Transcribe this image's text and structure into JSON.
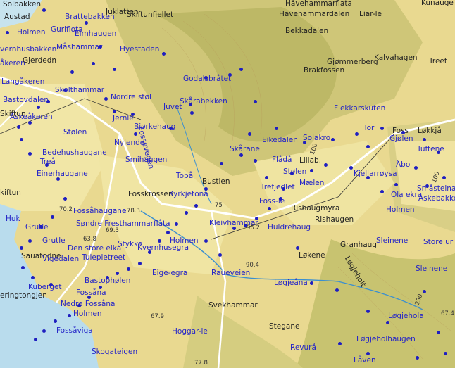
{
  "map": {
    "colors": {
      "land": "#e9d990",
      "hill": "#c9c26a",
      "forest_dark": "#a9ae57",
      "field": "#f1e6a6",
      "water": "#b9dced",
      "road": "#ffffff",
      "place_label": "#2424c8",
      "black_label": "#222222"
    },
    "labels": [
      {
        "id": "solbakken",
        "text": "Solbakken",
        "style": "black"
      },
      {
        "id": "austad",
        "text": "Austad",
        "style": "black"
      },
      {
        "id": "juklatten",
        "text": "Juklatten",
        "style": "black"
      },
      {
        "id": "skiftunfjellet",
        "text": "Skiftunfjellet",
        "style": "black"
      },
      {
        "id": "havehammarflata",
        "text": "Hävehammarflata",
        "style": "black"
      },
      {
        "id": "havehammardalen",
        "text": "Hävehammardalen",
        "style": "black"
      },
      {
        "id": "liar-le",
        "text": "Liar-le",
        "style": "black"
      },
      {
        "id": "kunauge",
        "text": "Kunauge",
        "style": "black"
      },
      {
        "id": "brattebakken",
        "text": "Brattebakken",
        "style": "blue"
      },
      {
        "id": "holmen-1",
        "text": "Holmen",
        "style": "blue"
      },
      {
        "id": "guriflota",
        "text": "Guriflota",
        "style": "blue"
      },
      {
        "id": "elmhaugen",
        "text": "Elmhaugen",
        "style": "blue"
      },
      {
        "id": "bekkadalen",
        "text": "Bekkadalen",
        "style": "black"
      },
      {
        "id": "vernhusbakken",
        "text": "vernhusbakken",
        "style": "blue"
      },
      {
        "id": "mashammar",
        "text": "Måshammar",
        "style": "blue"
      },
      {
        "id": "hyestaden",
        "text": "Hyestaden",
        "style": "blue"
      },
      {
        "id": "kalvahagen",
        "text": "Kalvahagen",
        "style": "black"
      },
      {
        "id": "akeren",
        "text": "åkeren",
        "style": "blue"
      },
      {
        "id": "gjerdedn",
        "text": "Gjerdedn",
        "style": "black"
      },
      {
        "id": "gjommerberg",
        "text": "Gjømmerberg",
        "style": "black"
      },
      {
        "id": "treet",
        "text": "Treet",
        "style": "black"
      },
      {
        "id": "brakfossen",
        "text": "Brakfossen",
        "style": "black"
      },
      {
        "id": "godalsbratet",
        "text": "Godalsbråtet",
        "style": "blue"
      },
      {
        "id": "langakeren",
        "text": "Langåkeren",
        "style": "blue"
      },
      {
        "id": "skolthammar",
        "text": "Skolthammar",
        "style": "blue"
      },
      {
        "id": "bastovdalen",
        "text": "Bastovdalen",
        "style": "blue"
      },
      {
        "id": "nordre-stol",
        "text": "Nordre støl",
        "style": "blue"
      },
      {
        "id": "skarabekken",
        "text": "Skårabekken",
        "style": "blue"
      },
      {
        "id": "juvet",
        "text": "Juvet",
        "style": "blue"
      },
      {
        "id": "flekkarskuten",
        "text": "Flekkarskuten",
        "style": "blue"
      },
      {
        "id": "skiftun",
        "text": "Skiftun",
        "style": "black"
      },
      {
        "id": "askeakeren",
        "text": "Askeåkeren",
        "style": "blue"
      },
      {
        "id": "jernle",
        "text": "Jernle",
        "style": "blue"
      },
      {
        "id": "bjorkehaug",
        "text": "Bjørkehaug",
        "style": "blue"
      },
      {
        "id": "tor",
        "text": "Tor",
        "style": "blue"
      },
      {
        "id": "foss",
        "text": "Foss",
        "style": "black"
      },
      {
        "id": "lokkja",
        "text": "Løkkjå",
        "style": "black"
      },
      {
        "id": "stolen-1",
        "text": "Stølen",
        "style": "blue"
      },
      {
        "id": "solakro",
        "text": "Solakro",
        "style": "blue"
      },
      {
        "id": "eikedalen",
        "text": "Eikedalen",
        "style": "blue"
      },
      {
        "id": "gjolen",
        "text": "Gjølen",
        "style": "blue"
      },
      {
        "id": "nylende",
        "text": "Nylende",
        "style": "blue"
      },
      {
        "id": "skarane",
        "text": "Skårane",
        "style": "blue"
      },
      {
        "id": "tuftene",
        "text": "Tuftene",
        "style": "blue"
      },
      {
        "id": "bedehushaugane",
        "text": "Bedehushaugane",
        "style": "blue"
      },
      {
        "id": "trea",
        "text": "Treå",
        "style": "blue"
      },
      {
        "id": "smihaugen",
        "text": "Smihaugen",
        "style": "blue"
      },
      {
        "id": "flada",
        "text": "Flådå",
        "style": "blue"
      },
      {
        "id": "lillab",
        "text": "Lillab.",
        "style": "black"
      },
      {
        "id": "abo",
        "text": "Åbo",
        "style": "blue"
      },
      {
        "id": "einerhaugane",
        "text": "Einerhaugane",
        "style": "blue"
      },
      {
        "id": "stolen-2",
        "text": "Stølen",
        "style": "blue"
      },
      {
        "id": "kjellarroysa",
        "text": "Kjellarrøysa",
        "style": "blue"
      },
      {
        "id": "topa",
        "text": "Topå",
        "style": "blue"
      },
      {
        "id": "bustien",
        "text": "Bustien",
        "style": "black"
      },
      {
        "id": "maelen",
        "text": "Mælen",
        "style": "blue"
      },
      {
        "id": "smasteina",
        "text": "Småsteina",
        "style": "blue"
      },
      {
        "id": "trefjedlet",
        "text": "Trefjedlet",
        "style": "blue"
      },
      {
        "id": "skiftun-2",
        "text": "kiftun",
        "style": "black"
      },
      {
        "id": "fosskrossen",
        "text": "Fosskrossen",
        "style": "black"
      },
      {
        "id": "kyrkjetona",
        "text": "Kyrkjetonå",
        "style": "blue"
      },
      {
        "id": "ola-ekra",
        "text": "Ola ekra",
        "style": "blue"
      },
      {
        "id": "askebakken",
        "text": "Askebakke",
        "style": "blue"
      },
      {
        "id": "foss-le",
        "text": "Foss-le",
        "style": "blue"
      },
      {
        "id": "fossahaugane",
        "text": "Fossåhaugane",
        "style": "blue"
      },
      {
        "id": "rishaugmyra",
        "text": "Rishaugmyra",
        "style": "black"
      },
      {
        "id": "holmen-2",
        "text": "Holmen",
        "style": "blue"
      },
      {
        "id": "huk",
        "text": "Huk",
        "style": "blue"
      },
      {
        "id": "rishaugen",
        "text": "Rishaugen",
        "style": "black"
      },
      {
        "id": "sondre-fresthammarflata",
        "text": "Søndre Fresthammarflåta",
        "style": "blue"
      },
      {
        "id": "kleivhammar",
        "text": "Kleivhammar",
        "style": "blue"
      },
      {
        "id": "grutle-1",
        "text": "Grutle",
        "style": "blue"
      },
      {
        "id": "huldrehaug",
        "text": "Huldrehaug",
        "style": "blue"
      },
      {
        "id": "sleinene-1",
        "text": "Sleinene",
        "style": "blue"
      },
      {
        "id": "store-ur",
        "text": "Store ur",
        "style": "blue"
      },
      {
        "id": "grutle-2",
        "text": "Grutle",
        "style": "blue"
      },
      {
        "id": "holmen-3",
        "text": "Holmen",
        "style": "blue"
      },
      {
        "id": "granhaug",
        "text": "Granhaug",
        "style": "black"
      },
      {
        "id": "den-store-eika",
        "text": "Den store eika",
        "style": "blue"
      },
      {
        "id": "stykke",
        "text": "Stykke",
        "style": "blue"
      },
      {
        "id": "kvernhusegra",
        "text": "Kvernhusegra",
        "style": "blue"
      },
      {
        "id": "sauatodne",
        "text": "Sauatodne",
        "style": "black"
      },
      {
        "id": "lokene",
        "text": "Løkene",
        "style": "black"
      },
      {
        "id": "tulepletreet",
        "text": "Tulepletreet",
        "style": "blue"
      },
      {
        "id": "vigedalen",
        "text": "Vigedalen",
        "style": "blue"
      },
      {
        "id": "loegjeholt",
        "text": "Løgjeholt",
        "style": "black"
      },
      {
        "id": "sleinene-2",
        "text": "Sleinene",
        "style": "blue"
      },
      {
        "id": "eige-egra",
        "text": "Eige-egra",
        "style": "blue"
      },
      {
        "id": "raueveien",
        "text": "Raueveien",
        "style": "blue"
      },
      {
        "id": "bastopholen",
        "text": "Bastophølen",
        "style": "blue"
      },
      {
        "id": "kuberget",
        "text": "Kuberget",
        "style": "blue"
      },
      {
        "id": "logjeana",
        "text": "Løgjeåna",
        "style": "blue"
      },
      {
        "id": "eringtongjen",
        "text": "eringtongjen",
        "style": "black"
      },
      {
        "id": "fossana",
        "text": "Fossåna",
        "style": "blue"
      },
      {
        "id": "nedrebostad",
        "text": "Nedre Fossåna",
        "style": "blue"
      },
      {
        "id": "svekhammar",
        "text": "Svekhammar",
        "style": "black"
      },
      {
        "id": "holmen-4",
        "text": "Holmen",
        "style": "blue"
      },
      {
        "id": "loegjehola",
        "text": "Løgjehola",
        "style": "blue"
      },
      {
        "id": "hoggar-le",
        "text": "Hoggar-le",
        "style": "blue"
      },
      {
        "id": "stegane",
        "text": "Stegane",
        "style": "black"
      },
      {
        "id": "fossaviga",
        "text": "Fossåviga",
        "style": "blue"
      },
      {
        "id": "loegjeholhaugen",
        "text": "Løgjeholhaugen",
        "style": "blue"
      },
      {
        "id": "revura",
        "text": "Revurå",
        "style": "blue"
      },
      {
        "id": "skogateigen",
        "text": "Skogateigen",
        "style": "blue"
      },
      {
        "id": "laven",
        "text": "Låven",
        "style": "blue"
      }
    ],
    "elevations": [
      "70.2",
      "78.3",
      "63.8",
      "69.3",
      "90.4",
      "96.2",
      "75",
      "67.9",
      "77.8",
      "100",
      "100",
      "250",
      "67.4"
    ],
    "road_labels": [
      {
        "id": "fossvegen",
        "text": "Fossevegen"
      }
    ],
    "place_points_count": 96
  }
}
